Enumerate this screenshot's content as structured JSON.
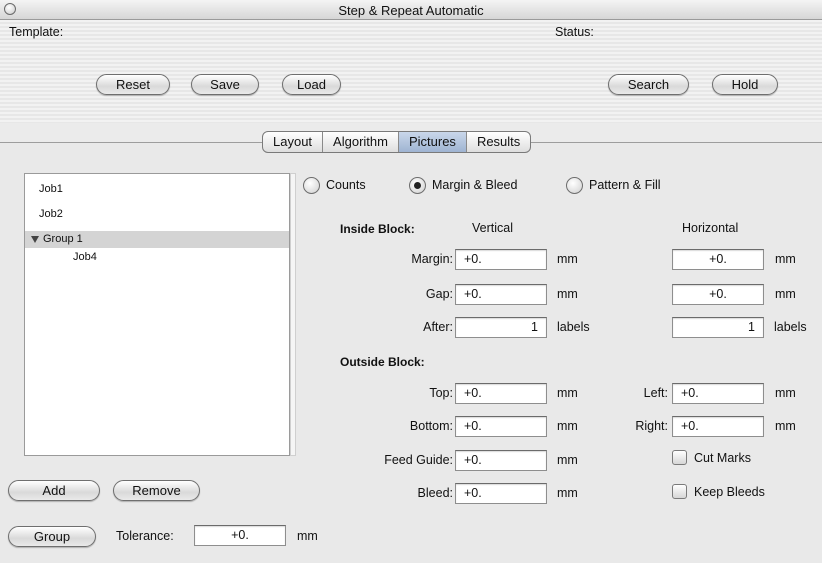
{
  "window": {
    "title": "Step & Repeat Automatic"
  },
  "top": {
    "template_label": "Template:",
    "status_label": "Status:",
    "reset_label": "Reset",
    "save_label": "Save",
    "load_label": "Load",
    "search_label": "Search",
    "hold_label": "Hold"
  },
  "tabs": [
    "Layout",
    "Algorithm",
    "Pictures",
    "Results"
  ],
  "active_tab": "Pictures",
  "jobs": {
    "items": [
      {
        "label": "Job1"
      },
      {
        "label": "Job2"
      },
      {
        "label": "Group 1"
      },
      {
        "label": "Job4"
      }
    ]
  },
  "left_buttons": {
    "add_label": "Add",
    "remove_label": "Remove",
    "group_label": "Group",
    "tolerance_label": "Tolerance:",
    "tolerance_value": "+0.",
    "tolerance_unit": "mm"
  },
  "mode": {
    "counts_label": "Counts",
    "margin_bleed_label": "Margin & Bleed",
    "pattern_fill_label": "Pattern & Fill",
    "selected": "Margin & Bleed"
  },
  "inside": {
    "heading": "Inside Block:",
    "vertical_header": "Vertical",
    "horizontal_header": "Horizontal",
    "margin_label": "Margin:",
    "margin_v": "+0.",
    "margin_v_unit": "mm",
    "margin_h": "+0.",
    "margin_h_unit": "mm",
    "gap_label": "Gap:",
    "gap_v": "+0.",
    "gap_v_unit": "mm",
    "gap_h": "+0.",
    "gap_h_unit": "mm",
    "after_label": "After:",
    "after_v": "1",
    "after_v_unit": "labels",
    "after_h": "1",
    "after_h_unit": "labels"
  },
  "outside": {
    "heading": "Outside Block:",
    "top_label": "Top:",
    "top_value": "+0.",
    "top_unit": "mm",
    "bottom_label": "Bottom:",
    "bottom_value": "+0.",
    "bottom_unit": "mm",
    "feed_guide_label": "Feed Guide:",
    "feed_guide_value": "+0.",
    "feed_guide_unit": "mm",
    "bleed_label": "Bleed:",
    "bleed_value": "+0.",
    "bleed_unit": "mm",
    "left_label": "Left:",
    "left_value": "+0.",
    "left_unit": "mm",
    "right_label": "Right:",
    "right_value": "+0.",
    "right_unit": "mm",
    "cut_marks_label": "Cut Marks",
    "keep_bleeds_label": "Keep Bleeds"
  }
}
